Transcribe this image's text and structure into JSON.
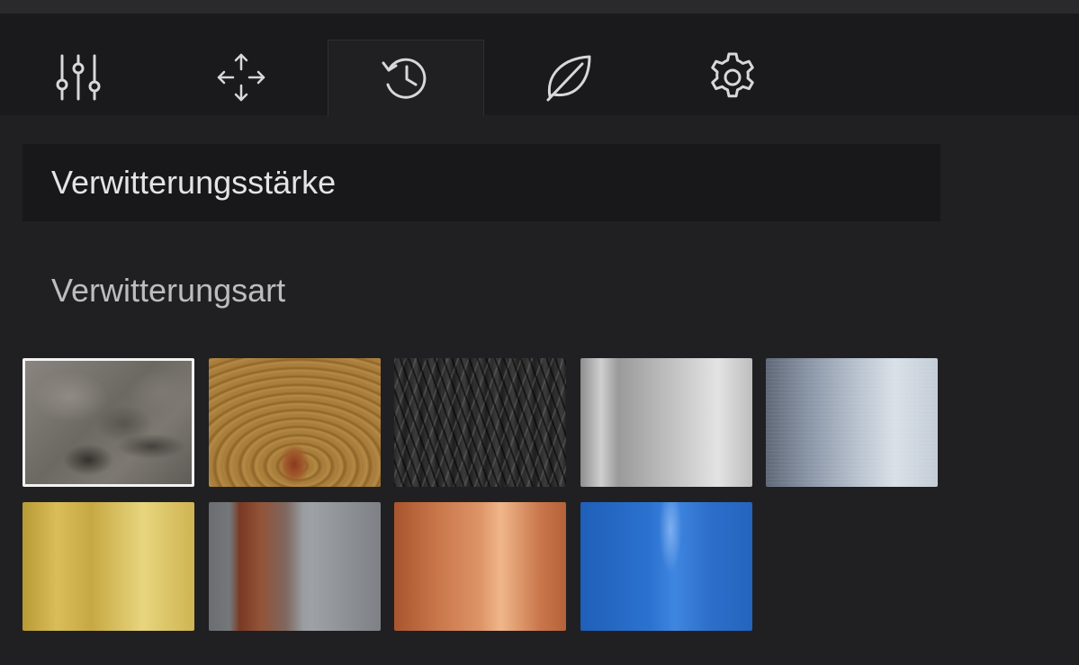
{
  "tabs": [
    {
      "icon": "sliders-icon",
      "active": false
    },
    {
      "icon": "move-arrows-icon",
      "active": false
    },
    {
      "icon": "history-icon",
      "active": true
    },
    {
      "icon": "leaf-icon",
      "active": false
    },
    {
      "icon": "gear-icon",
      "active": false
    }
  ],
  "panel": {
    "strength_label": "Verwitterungsstärke",
    "type_label": "Verwitterungsart"
  },
  "swatches": [
    {
      "name": "stone",
      "selected": true
    },
    {
      "name": "wood",
      "selected": false
    },
    {
      "name": "dark-weave",
      "selected": false
    },
    {
      "name": "silver",
      "selected": false
    },
    {
      "name": "brushed-steel",
      "selected": false
    },
    {
      "name": "gold",
      "selected": false
    },
    {
      "name": "rusted-metal",
      "selected": false
    },
    {
      "name": "copper",
      "selected": false
    },
    {
      "name": "blue-metal",
      "selected": false
    }
  ],
  "colors": {
    "background": "#202022",
    "tabbar": "#1a1a1c",
    "icon": "#d8d8da",
    "selected_border": "#f2f2f2"
  }
}
